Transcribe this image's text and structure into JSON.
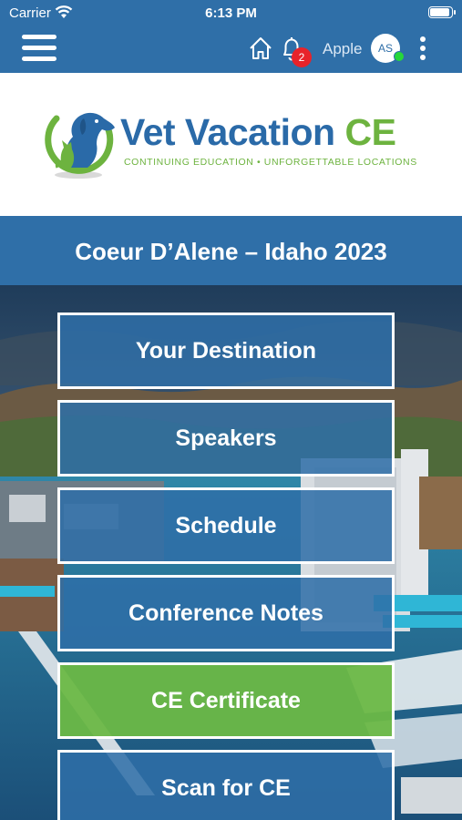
{
  "status_bar": {
    "carrier": "Carrier",
    "time": "6:13 PM",
    "battery_level": 0.95
  },
  "app_bar": {
    "menu_icon": "hamburger-menu-icon",
    "home_icon": "home-icon",
    "notifications_icon": "bell-icon",
    "notification_count": "2",
    "username": "Apple",
    "avatar_initials": "AS",
    "more_icon": "more-vertical-icon",
    "colors": {
      "bar": "#2f6fa8",
      "badge": "#e8232a",
      "online": "#27d73a"
    }
  },
  "logo": {
    "title_main": "Vet Vacation",
    "title_accent": "CE",
    "tagline": "CONTINUING EDUCATION • UNFORGETTABLE LOCATIONS",
    "colors": {
      "blue": "#2a6aa8",
      "green": "#6db33f"
    }
  },
  "event": {
    "title": "Coeur D’Alene – Idaho 2023"
  },
  "menu": {
    "items": [
      {
        "label": "Your Destination"
      },
      {
        "label": "Speakers"
      },
      {
        "label": "Schedule"
      },
      {
        "label": "Conference Notes"
      },
      {
        "label": "CE Certificate",
        "highlight": true
      },
      {
        "label": "Scan for CE"
      }
    ],
    "colors": {
      "button": "#2f6fa8",
      "highlight": "#6cb846",
      "border": "#ffffff"
    }
  }
}
